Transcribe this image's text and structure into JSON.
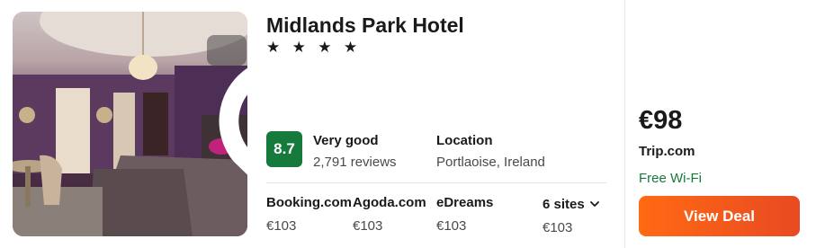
{
  "hotel": {
    "name": "Midlands Park Hotel",
    "stars": "★ ★ ★ ★",
    "star_count": 4
  },
  "rating": {
    "score": "8.7",
    "label": "Very good",
    "reviews": "2,791 reviews",
    "score_color": "#157a3c"
  },
  "location": {
    "label": "Location",
    "value": "Portlaoise, Ireland"
  },
  "sites": [
    {
      "name": "Booking.com",
      "price": "€103"
    },
    {
      "name": "Agoda.com",
      "price": "€103"
    },
    {
      "name": "eDreams",
      "price": "€103"
    }
  ],
  "more_sites": {
    "label": "6 sites",
    "price": "€103"
  },
  "deal": {
    "price": "€98",
    "provider": "Trip.com",
    "amenity": "Free Wi-Fi",
    "amenity_color": "#157a3c",
    "button_label": "View Deal",
    "button_color": "#ff6a13"
  },
  "icons": {
    "favorite": "heart-outline-icon",
    "expand": "chevron-down-icon"
  }
}
